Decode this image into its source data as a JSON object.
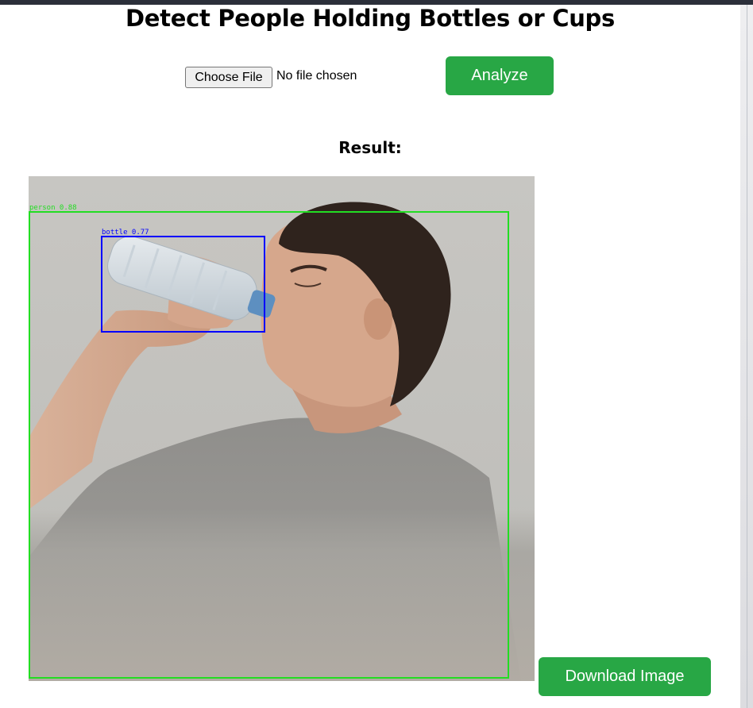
{
  "page": {
    "title": "Detect People Holding Bottles or Cups"
  },
  "upload": {
    "choose_file_label": "Choose File",
    "file_status": "No file chosen",
    "analyze_label": "Analyze"
  },
  "result": {
    "heading": "Result:",
    "image_description_alt": "Detection result image",
    "detections": [
      {
        "label": "person 0.88",
        "color": "#22dd22"
      },
      {
        "label": "bottle 0.77",
        "color": "#0000ff"
      }
    ],
    "download_label": "Download Image"
  },
  "colors": {
    "button_green": "#28a745",
    "person_box": "#22dd22",
    "bottle_box": "#0000ff"
  }
}
